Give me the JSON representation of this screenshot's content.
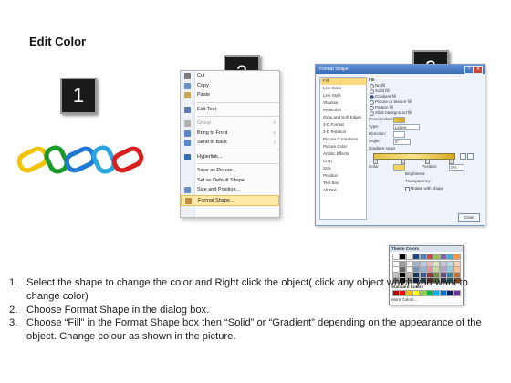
{
  "title": "Edit Color",
  "badges": [
    "1",
    "2",
    "3"
  ],
  "context_menu": {
    "items": [
      {
        "label": "Cut",
        "icon": "scissors-icon",
        "color": "#7a7a7a",
        "submenu": false,
        "disabled": false
      },
      {
        "label": "Copy",
        "icon": "copy-icon",
        "color": "#6b8fc7",
        "submenu": false,
        "disabled": false
      },
      {
        "label": "Paste",
        "icon": "paste-icon",
        "color": "#c9a55a",
        "submenu": false,
        "disabled": false
      },
      {
        "sep": true
      },
      {
        "label": "Edit Text",
        "icon": "edit-text-icon",
        "color": "#5a7ab0",
        "submenu": false,
        "disabled": false
      },
      {
        "sep": true
      },
      {
        "label": "Group",
        "icon": "group-icon",
        "color": "#b0b0b0",
        "submenu": true,
        "disabled": true
      },
      {
        "label": "Bring to Front",
        "icon": "bring-front-icon",
        "color": "#5b86c8",
        "submenu": true,
        "disabled": false
      },
      {
        "label": "Send to Back",
        "icon": "send-back-icon",
        "color": "#5b86c8",
        "submenu": true,
        "disabled": false
      },
      {
        "sep": true
      },
      {
        "label": "Hyperlink...",
        "icon": "hyperlink-icon",
        "color": "#3b6bb5",
        "submenu": false,
        "disabled": false
      },
      {
        "sep": true
      },
      {
        "label": "Save as Picture...",
        "icon": "",
        "color": "",
        "submenu": false,
        "disabled": false
      },
      {
        "label": "Set as Default Shape",
        "icon": "",
        "color": "",
        "submenu": false,
        "disabled": false
      },
      {
        "label": "Size and Position...",
        "icon": "size-position-icon",
        "color": "#6a8fc0",
        "submenu": false,
        "disabled": false
      },
      {
        "label": "Format Shape...",
        "icon": "format-shape-icon",
        "color": "#c08a3a",
        "submenu": false,
        "disabled": false,
        "highlighted": true
      }
    ]
  },
  "dialog": {
    "title": "Format Shape",
    "help_glyph": "?",
    "close_glyph": "X",
    "categories": [
      "Fill",
      "Line Color",
      "Line Style",
      "Shadow",
      "Reflection",
      "Glow and Soft Edges",
      "3-D Format",
      "3-D Rotation",
      "Picture Corrections",
      "Picture Color",
      "Artistic Effects",
      "Crop",
      "Size",
      "Position",
      "Text Box",
      "Alt Text"
    ],
    "selected_category": "Fill",
    "fill_heading": "Fill",
    "fill_options": [
      {
        "label": "No fill",
        "on": false
      },
      {
        "label": "Solid fill",
        "on": false
      },
      {
        "label": "Gradient fill",
        "on": true
      },
      {
        "label": "Picture or texture fill",
        "on": false
      },
      {
        "label": "Pattern fill",
        "on": false
      },
      {
        "label": "Slide background fill",
        "on": false
      }
    ],
    "preset_colors_label": "Preset colors:",
    "type_label": "Type:",
    "type_value": "Linear",
    "direction_label": "Direction:",
    "angle_label": "Angle:",
    "angle_value": "0°",
    "gradient_stops_label": "Gradient stops",
    "color_label": "Color",
    "position_label": "Position:",
    "position_value": "0%",
    "brightness_label": "Brightness:",
    "transparency_label": "Transparency:",
    "rotate_label": "Rotate with shape",
    "close_label": "Close"
  },
  "palette": {
    "theme_colors_label": "Theme Colors",
    "standard_colors_label": "Standard Colors",
    "more_colors_label": "More Colors...",
    "theme_top": [
      "#ffffff",
      "#000000",
      "#eeece1",
      "#1f497d",
      "#4f81bd",
      "#c0504d",
      "#9bbb59",
      "#8064a2",
      "#4bacc6",
      "#f79646"
    ],
    "standard": [
      "#c00000",
      "#ff0000",
      "#ffc000",
      "#ffff00",
      "#92d050",
      "#00b050",
      "#00b0f0",
      "#0070c0",
      "#002060",
      "#7030a0"
    ]
  },
  "chain_colors": [
    "#f2c300",
    "#1a9a2a",
    "#1f78d1",
    "#2aa5e0",
    "#d8201e"
  ],
  "instructions": [
    {
      "num": "1.",
      "text": "Select the shape to change the color and Right click the object( click any object which you want to change color)"
    },
    {
      "num": "2.",
      "text": "Choose Format Shape in the dialog box."
    },
    {
      "num": "3.",
      "text": "Choose “Fill” in the Format Shape box then “Solid” or “Gradient” depending on the appearance of the object. Change colour as shown in the picture."
    }
  ]
}
